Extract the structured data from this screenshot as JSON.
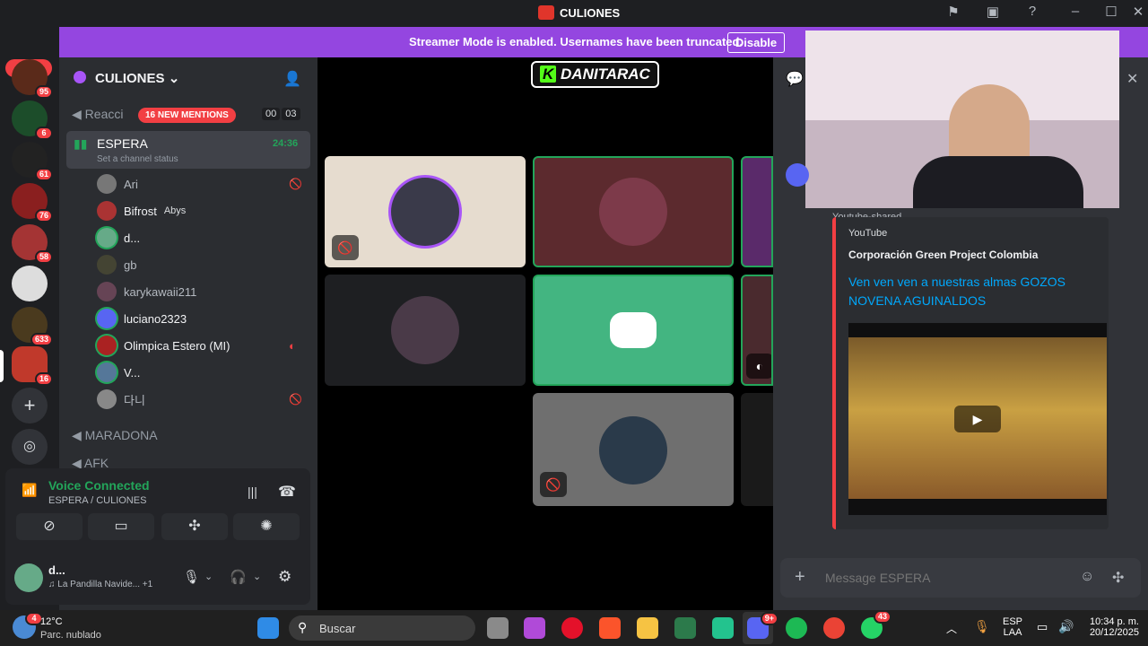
{
  "window": {
    "title": "CULIONES"
  },
  "banner": {
    "text": "Streamer Mode is enabled. Usernames have been truncated.",
    "button": "Disable"
  },
  "rail": {
    "new_pill": "NEW",
    "badges": [
      "95",
      "6",
      "61",
      "76",
      "58",
      "633",
      "16"
    ]
  },
  "server": {
    "name": "CULIONES"
  },
  "channels": {
    "first": "Reacci",
    "mentions": "16 NEW MENTIONS",
    "first_counts": [
      "00",
      "03"
    ],
    "active": "ESPERA",
    "active_timer": "24:36",
    "status_hint": "Set a channel status",
    "second": "MARADONA",
    "third": "AFK"
  },
  "members": [
    {
      "name": "Ari"
    },
    {
      "name": "Bifrost",
      "tag": "Abys"
    },
    {
      "name": "d..."
    },
    {
      "name": "gb"
    },
    {
      "name": "karykawaii211"
    },
    {
      "name": "luciano2323"
    },
    {
      "name": "Olimpica Estero (MI)"
    },
    {
      "name": "V..."
    },
    {
      "name": "다니"
    }
  ],
  "voice": {
    "status": "Voice Connected",
    "location": "ESPERA / CULIONES"
  },
  "user": {
    "name": "d...",
    "activity": "La Pandilla Navide...",
    "extra": "+1"
  },
  "stage": {
    "streamer_label": "DANITARAC"
  },
  "embed": {
    "partial_label": "Youtube-shared",
    "provider": "YouTube",
    "author": "Corporación Green Project Colombia",
    "title": "Ven ven ven a nuestras almas GOZOS NOVENA AGUINALDOS"
  },
  "composer": {
    "placeholder": "Message ESPERA"
  },
  "taskbar": {
    "weather_temp": "12°C",
    "weather_desc": "Parc. nublado",
    "weather_badge": "4",
    "search": "Buscar",
    "discord_badge": "9+",
    "whatsapp_badge": "43",
    "lang1": "ESP",
    "lang2": "LAA",
    "time": "10:34 p. m.",
    "date": "20/12/2025"
  },
  "colors": {
    "accent": "#9446e0",
    "green": "#23a55a",
    "red": "#f23f43",
    "link": "#00a8fc"
  }
}
